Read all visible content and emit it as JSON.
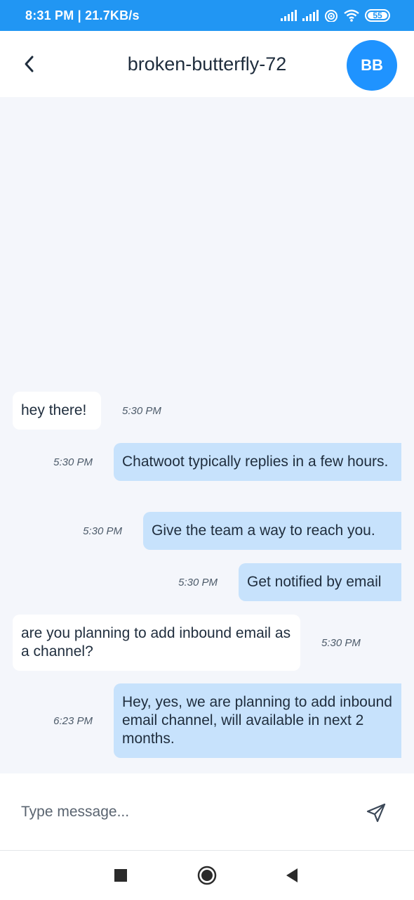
{
  "status_bar": {
    "time_speed": "8:31 PM | 21.7KB/s",
    "battery": "55"
  },
  "header": {
    "title": "broken-butterfly-72",
    "avatar_initials": "BB"
  },
  "messages": [
    {
      "direction": "incoming",
      "text": "hey there!",
      "time": "5:30 PM"
    },
    {
      "direction": "outgoing",
      "text": "Chatwoot typically replies in a few hours.",
      "time": "5:30 PM"
    },
    {
      "direction": "outgoing",
      "text": "Give the team a way to reach you.",
      "time": "5:30 PM"
    },
    {
      "direction": "outgoing",
      "text": "Get notified by email",
      "time": "5:30 PM"
    },
    {
      "direction": "incoming",
      "text": "are you planning to add inbound email as a channel?",
      "time": "5:30 PM"
    },
    {
      "direction": "outgoing",
      "text": "Hey, yes, we are planning to add inbound email channel, will available in next 2 months.",
      "time": "6:23 PM"
    }
  ],
  "composer": {
    "placeholder": "Type message...",
    "value": ""
  },
  "icons": {
    "back": "chevron-left-icon",
    "send": "send-icon",
    "recents": "square-icon",
    "home": "circle-icon",
    "nav_back": "triangle-left-icon"
  },
  "colors": {
    "accent": "#2196f3",
    "avatar": "#1f93ff",
    "outgoing_bubble": "#c7e2fc",
    "incoming_bubble": "#ffffff",
    "background": "#f4f6fb"
  }
}
